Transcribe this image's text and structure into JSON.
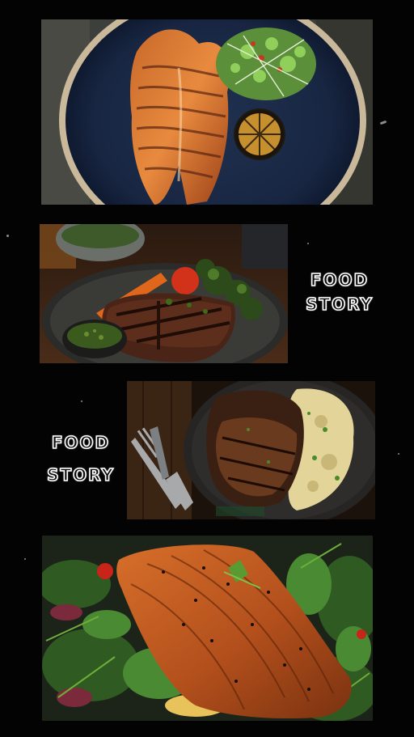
{
  "background_color": "#030303",
  "captions": [
    {
      "line1": "FOOD",
      "line2": "STORY"
    },
    {
      "line1": "FOOD",
      "line2": "STORY"
    }
  ],
  "photos": [
    {
      "subject": "grilled salmon steak on dark blue plate with microgreens and charred lemon"
    },
    {
      "subject": "grilled steak with roasted vegetables and chimichurri"
    },
    {
      "subject": "grilled meat with mashed potatoes, fork and knife"
    },
    {
      "subject": "seared salmon fillet on mixed green salad"
    }
  ]
}
